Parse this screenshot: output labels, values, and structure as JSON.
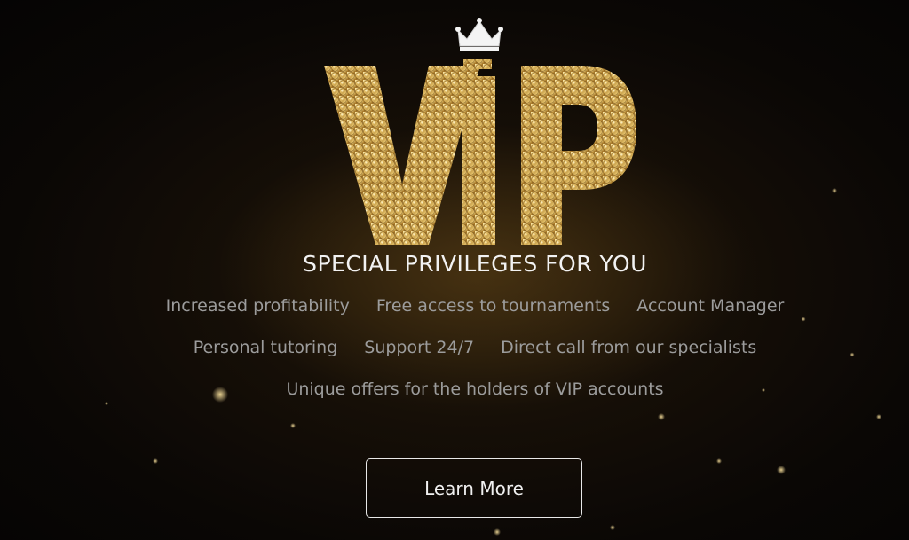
{
  "hero": {
    "logo_text": "VIP",
    "tagline": "SPECIAL PRIVILEGES FOR YOU",
    "features": {
      "row1": [
        "Increased profitability",
        "Free access to tournaments",
        "Account Manager"
      ],
      "row2": [
        "Personal tutoring",
        "Support 24/7",
        "Direct call from our specialists"
      ],
      "row3": [
        "Unique offers for the holders of VIP accounts"
      ]
    },
    "cta_label": "Learn More"
  },
  "colors": {
    "background": "#0b0805",
    "gold": "#d8b25a",
    "tagline": "#f2f2f2",
    "feature_text": "#9c9c9c",
    "button_border": "#e8e8e8"
  },
  "icons": {
    "crown": "crown-icon"
  }
}
